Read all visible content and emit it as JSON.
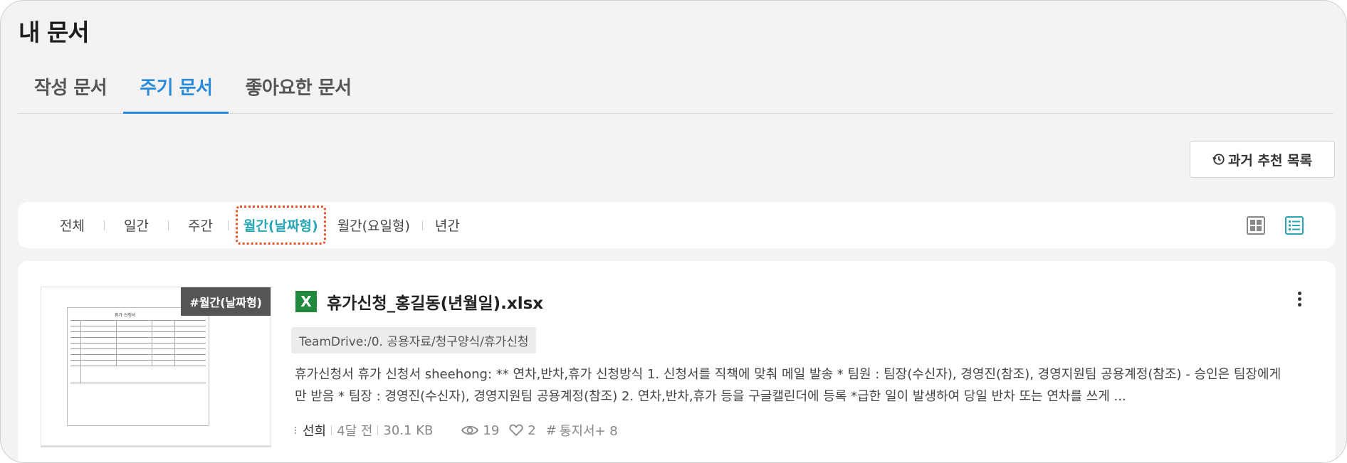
{
  "page": {
    "title": "내 문서"
  },
  "tabs": [
    {
      "label": "작성 문서",
      "active": false
    },
    {
      "label": "주기 문서",
      "active": true
    },
    {
      "label": "좋아요한 문서",
      "active": false
    }
  ],
  "history_button": {
    "label": "과거 추천 목록",
    "icon": "history-icon"
  },
  "filters": [
    {
      "label": "전체",
      "active": false
    },
    {
      "label": "일간",
      "active": false
    },
    {
      "label": "주간",
      "active": false
    },
    {
      "label": "월간(날짜형)",
      "active": true
    },
    {
      "label": "월간(요일형)",
      "active": false
    },
    {
      "label": "년간",
      "active": false
    }
  ],
  "view_toggles": {
    "grid_icon": "grid-view-icon",
    "list_icon": "list-view-icon",
    "active": "list"
  },
  "document": {
    "tag": "#월간(날짜형)",
    "file_icon": "X",
    "file_name": "휴가신청_홍길동(년월일).xlsx",
    "path": "TeamDrive:/0. 공용자료/청구양식/휴가신청",
    "description": "휴가신청서 휴가 신청서 sheehong: ** 연차,반차,휴가 신청방식 1. 신청서를 직책에 맞춰 메일 발송 * 팀원 : 팀장(수신자), 경영진(참조), 경영지원팀 공용계정(참조) - 승인은 팀장에게만 받음 * 팀장 : 경영진(수신자), 경영지원팀 공용계정(참조) 2. 연차,반차,휴가 등을 구글캘린더에 등록 *급한 일이 발생하여 당일 반차 또는 연차를 쓰게 ...",
    "author": "선희",
    "time_ago": "4달 전",
    "size": "30.1 KB",
    "views": "19",
    "likes": "2",
    "tags": "통지서+ 8",
    "preview_title": "휴가 신청서"
  },
  "colors": {
    "accent_tab": "#2a8bdc",
    "accent_filter": "#2aa7b5",
    "highlight": "#e8542c",
    "excel": "#1f8a3d"
  }
}
